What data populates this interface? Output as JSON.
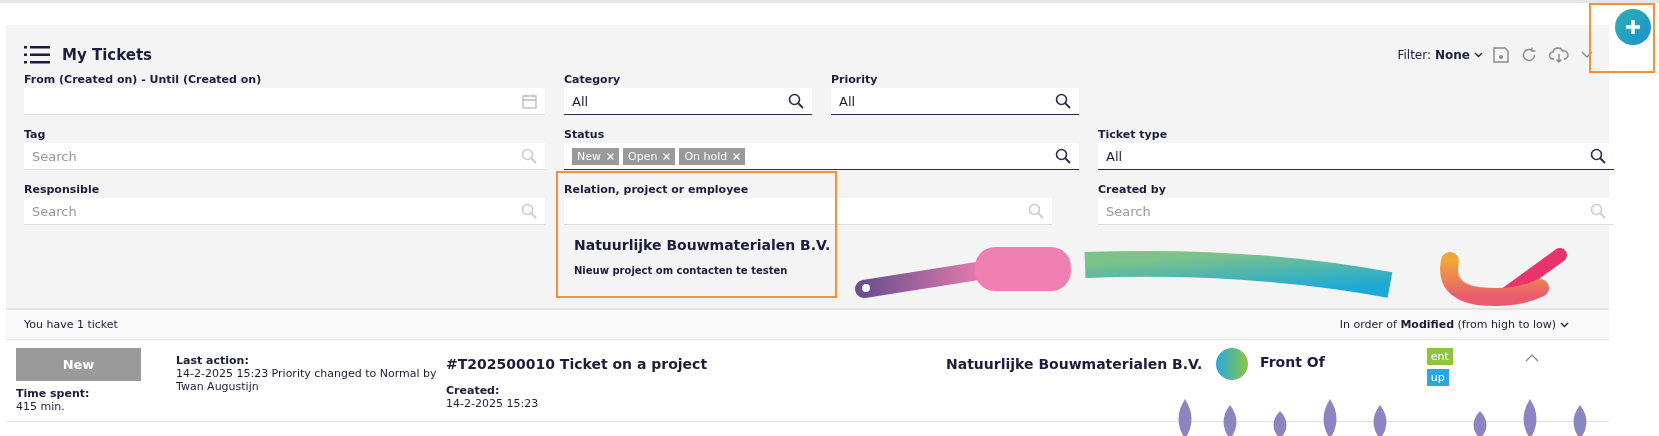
{
  "header": {
    "title": "My Tickets",
    "filter_label": "Filter:",
    "filter_value": "None"
  },
  "filters": [
    {
      "label": "From (Created on) - Until (Created on)",
      "kind": "date"
    },
    {
      "label": "Category",
      "kind": "search",
      "value": "All"
    },
    {
      "label": "Priority",
      "kind": "search",
      "value": "All"
    },
    {
      "label": "Tag",
      "kind": "search",
      "placeholder": "Search"
    },
    {
      "label": "Status",
      "kind": "tags",
      "tags": [
        "New",
        "Open",
        "On hold"
      ]
    },
    {
      "label": "Ticket type",
      "kind": "search",
      "value": "All"
    },
    {
      "label": "Responsible",
      "kind": "search",
      "placeholder": "Search"
    },
    {
      "label": "Relation, project or employee",
      "kind": "dropdown",
      "options": [
        {
          "title": "Natuurlijke Bouwmaterialen B.V.",
          "subtitle": "Nieuw project om contacten te testen"
        }
      ]
    },
    {
      "label": "Created by",
      "kind": "search",
      "placeholder": "Search"
    }
  ],
  "summary": "You have 1 ticket",
  "sort": "In order of **Modified** (from high to low)",
  "tickets": [
    {
      "status": "New",
      "time_spent_label": "Time spent:",
      "time_spent": "415 min.",
      "last_action_label": "Last action:",
      "last_action": "14-2-2025 15:23 Priority changed to Normal by Twan Augustijn",
      "title": "#T202500010 Ticket on a project",
      "created_label": "Created:",
      "created": "14-2-2025 15:23",
      "company": "Natuurlijke Bouwmaterialen B.V.",
      "office": "Front Of",
      "tags": [
        {
          "label": "ent",
          "color": "#8cc63f"
        },
        {
          "label": "up",
          "color": "#29a8e0"
        }
      ],
      "expanded": true
    }
  ]
}
